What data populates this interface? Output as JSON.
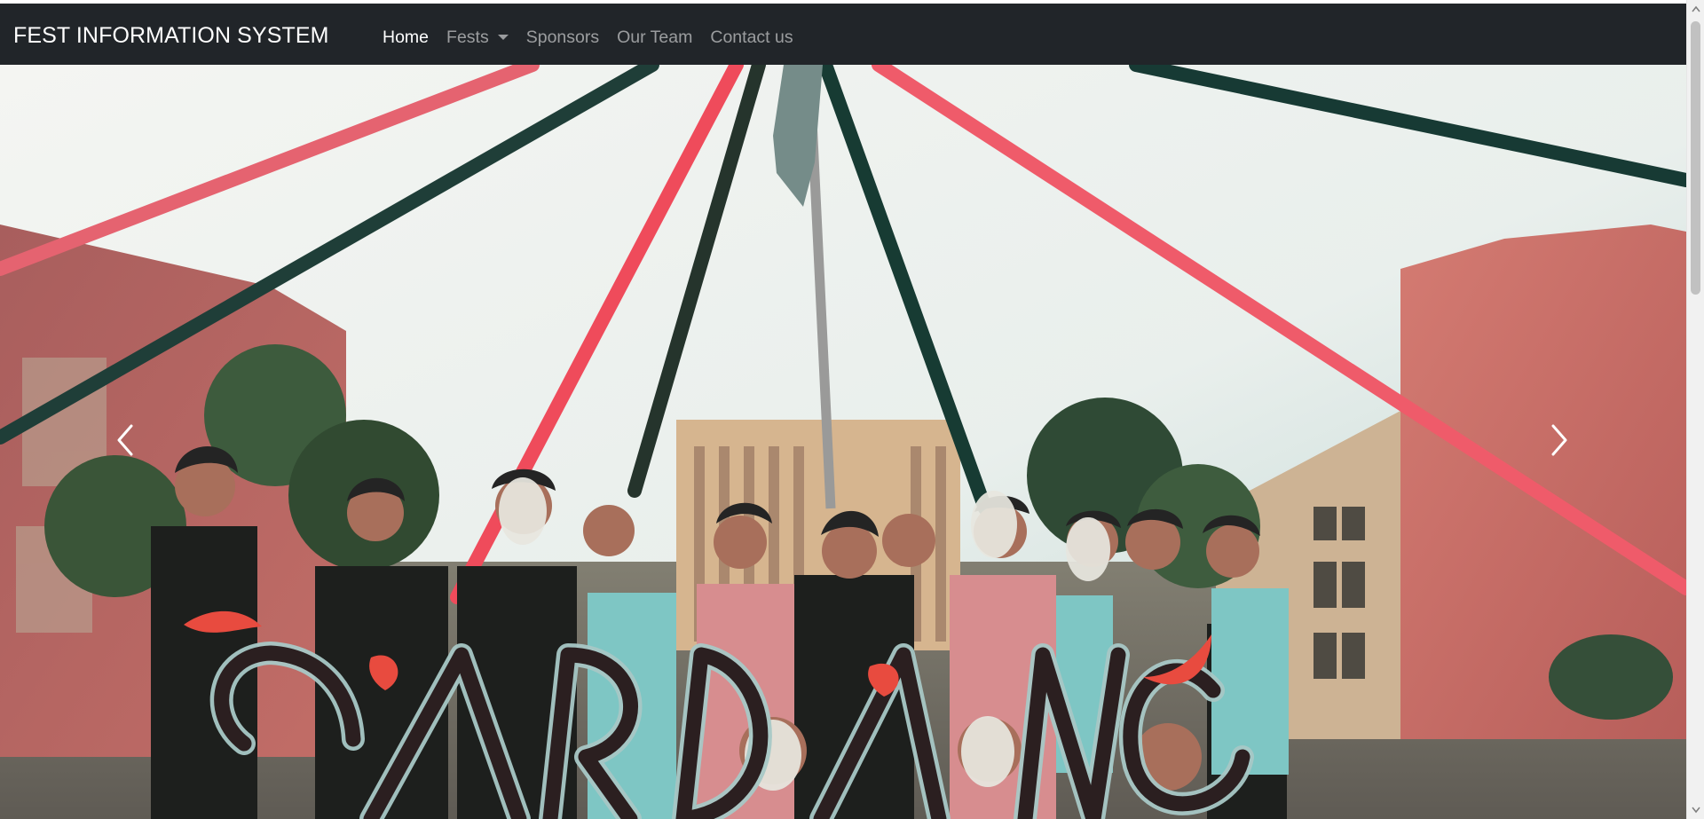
{
  "navbar": {
    "brand": "FEST INFORMATION SYSTEM",
    "items": [
      {
        "label": "Home",
        "active": true
      },
      {
        "label": "Fests",
        "has_dropdown": true
      },
      {
        "label": "Sponsors"
      },
      {
        "label": "Our Team"
      },
      {
        "label": "Contact us"
      }
    ]
  },
  "carousel": {
    "prev_icon": "chevron-left-icon",
    "next_icon": "chevron-right-icon"
  },
  "theme": {
    "navbar_background": "#212529",
    "nav_active": "#ffffff",
    "nav_inactive": "rgba(255,255,255,0.55)"
  }
}
